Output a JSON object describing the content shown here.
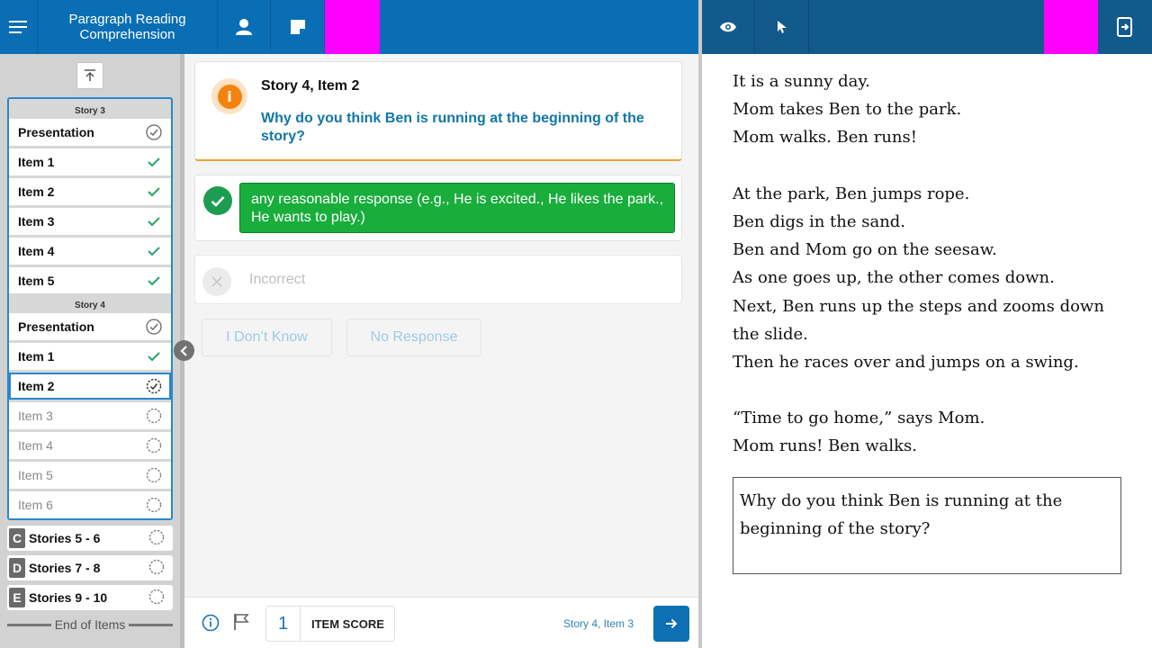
{
  "header": {
    "title_line1": "Paragraph Reading",
    "title_line2": "Comprehension",
    "icons": [
      "menu-icon",
      "person-icon",
      "note-icon",
      "eye-icon",
      "pointer-icon",
      "exit-icon"
    ],
    "accent_color": "#ff00ff"
  },
  "sidebar": {
    "story3": {
      "label": "Story 3",
      "items": [
        {
          "label": "Presentation",
          "status": "presented"
        },
        {
          "label": "Item 1",
          "status": "done"
        },
        {
          "label": "Item 2",
          "status": "done"
        },
        {
          "label": "Item 3",
          "status": "done"
        },
        {
          "label": "Item 4",
          "status": "done"
        },
        {
          "label": "Item 5",
          "status": "done"
        }
      ]
    },
    "story4": {
      "label": "Story 4",
      "items": [
        {
          "label": "Presentation",
          "status": "presented"
        },
        {
          "label": "Item 1",
          "status": "done"
        },
        {
          "label": "Item 2",
          "status": "current"
        },
        {
          "label": "Item 3",
          "status": "pending"
        },
        {
          "label": "Item 4",
          "status": "pending"
        },
        {
          "label": "Item 5",
          "status": "pending"
        },
        {
          "label": "Item 6",
          "status": "pending"
        }
      ]
    },
    "sections": [
      {
        "letter": "C",
        "label": "Stories 5 - 6"
      },
      {
        "letter": "D",
        "label": "Stories 7 - 8"
      },
      {
        "letter": "E",
        "label": "Stories 9 - 10"
      }
    ],
    "end_label": "End of Items"
  },
  "question": {
    "title": "Story 4, Item 2",
    "text": "Why do you think Ben is running at the beginning of the story?",
    "correct_response": "any reasonable response (e.g., He is excited., He likes the park., He wants to play.)",
    "incorrect_label": "Incorrect",
    "dont_know_label": "I Don’t Know",
    "no_response_label": "No Response"
  },
  "footer": {
    "score_value": "1",
    "score_label": "ITEM SCORE",
    "next_label": "Story 4, Item 3"
  },
  "story": {
    "lines": [
      "It is a sunny day.",
      "Mom takes Ben to the park.",
      "Mom walks. Ben runs!",
      "",
      "At the park, Ben jumps rope.",
      "Ben digs in the sand.",
      "Ben and Mom go on the seesaw.",
      "As one goes up, the other comes down.",
      "Next, Ben runs up the steps and zooms down",
      "the slide.",
      "Then he races over and jumps on a swing.",
      "",
      "“Time to go home,” says Mom.",
      "Mom runs! Ben walks."
    ],
    "question_box": "Why do you think Ben is running at the beginning of the story?"
  }
}
